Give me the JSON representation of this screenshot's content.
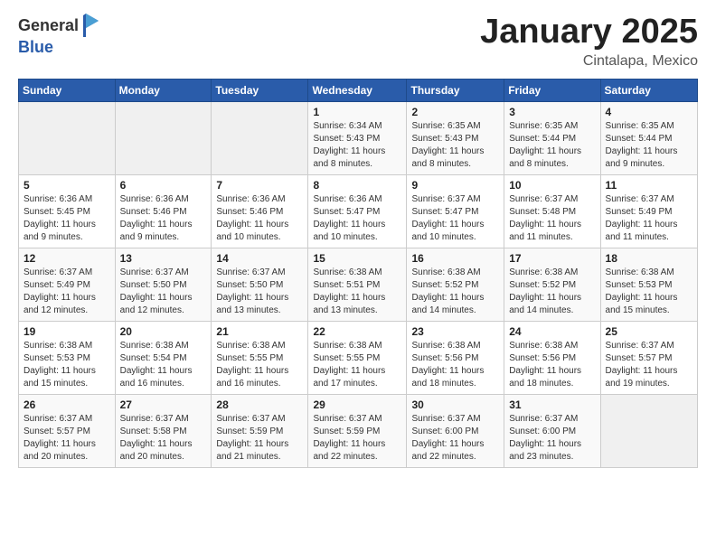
{
  "header": {
    "logo_general": "General",
    "logo_blue": "Blue",
    "month_title": "January 2025",
    "location": "Cintalapa, Mexico"
  },
  "weekdays": [
    "Sunday",
    "Monday",
    "Tuesday",
    "Wednesday",
    "Thursday",
    "Friday",
    "Saturday"
  ],
  "weeks": [
    [
      {
        "day": "",
        "info": ""
      },
      {
        "day": "",
        "info": ""
      },
      {
        "day": "",
        "info": ""
      },
      {
        "day": "1",
        "info": "Sunrise: 6:34 AM\nSunset: 5:43 PM\nDaylight: 11 hours and 8 minutes."
      },
      {
        "day": "2",
        "info": "Sunrise: 6:35 AM\nSunset: 5:43 PM\nDaylight: 11 hours and 8 minutes."
      },
      {
        "day": "3",
        "info": "Sunrise: 6:35 AM\nSunset: 5:44 PM\nDaylight: 11 hours and 8 minutes."
      },
      {
        "day": "4",
        "info": "Sunrise: 6:35 AM\nSunset: 5:44 PM\nDaylight: 11 hours and 9 minutes."
      }
    ],
    [
      {
        "day": "5",
        "info": "Sunrise: 6:36 AM\nSunset: 5:45 PM\nDaylight: 11 hours and 9 minutes."
      },
      {
        "day": "6",
        "info": "Sunrise: 6:36 AM\nSunset: 5:46 PM\nDaylight: 11 hours and 9 minutes."
      },
      {
        "day": "7",
        "info": "Sunrise: 6:36 AM\nSunset: 5:46 PM\nDaylight: 11 hours and 10 minutes."
      },
      {
        "day": "8",
        "info": "Sunrise: 6:36 AM\nSunset: 5:47 PM\nDaylight: 11 hours and 10 minutes."
      },
      {
        "day": "9",
        "info": "Sunrise: 6:37 AM\nSunset: 5:47 PM\nDaylight: 11 hours and 10 minutes."
      },
      {
        "day": "10",
        "info": "Sunrise: 6:37 AM\nSunset: 5:48 PM\nDaylight: 11 hours and 11 minutes."
      },
      {
        "day": "11",
        "info": "Sunrise: 6:37 AM\nSunset: 5:49 PM\nDaylight: 11 hours and 11 minutes."
      }
    ],
    [
      {
        "day": "12",
        "info": "Sunrise: 6:37 AM\nSunset: 5:49 PM\nDaylight: 11 hours and 12 minutes."
      },
      {
        "day": "13",
        "info": "Sunrise: 6:37 AM\nSunset: 5:50 PM\nDaylight: 11 hours and 12 minutes."
      },
      {
        "day": "14",
        "info": "Sunrise: 6:37 AM\nSunset: 5:50 PM\nDaylight: 11 hours and 13 minutes."
      },
      {
        "day": "15",
        "info": "Sunrise: 6:38 AM\nSunset: 5:51 PM\nDaylight: 11 hours and 13 minutes."
      },
      {
        "day": "16",
        "info": "Sunrise: 6:38 AM\nSunset: 5:52 PM\nDaylight: 11 hours and 14 minutes."
      },
      {
        "day": "17",
        "info": "Sunrise: 6:38 AM\nSunset: 5:52 PM\nDaylight: 11 hours and 14 minutes."
      },
      {
        "day": "18",
        "info": "Sunrise: 6:38 AM\nSunset: 5:53 PM\nDaylight: 11 hours and 15 minutes."
      }
    ],
    [
      {
        "day": "19",
        "info": "Sunrise: 6:38 AM\nSunset: 5:53 PM\nDaylight: 11 hours and 15 minutes."
      },
      {
        "day": "20",
        "info": "Sunrise: 6:38 AM\nSunset: 5:54 PM\nDaylight: 11 hours and 16 minutes."
      },
      {
        "day": "21",
        "info": "Sunrise: 6:38 AM\nSunset: 5:55 PM\nDaylight: 11 hours and 16 minutes."
      },
      {
        "day": "22",
        "info": "Sunrise: 6:38 AM\nSunset: 5:55 PM\nDaylight: 11 hours and 17 minutes."
      },
      {
        "day": "23",
        "info": "Sunrise: 6:38 AM\nSunset: 5:56 PM\nDaylight: 11 hours and 18 minutes."
      },
      {
        "day": "24",
        "info": "Sunrise: 6:38 AM\nSunset: 5:56 PM\nDaylight: 11 hours and 18 minutes."
      },
      {
        "day": "25",
        "info": "Sunrise: 6:37 AM\nSunset: 5:57 PM\nDaylight: 11 hours and 19 minutes."
      }
    ],
    [
      {
        "day": "26",
        "info": "Sunrise: 6:37 AM\nSunset: 5:57 PM\nDaylight: 11 hours and 20 minutes."
      },
      {
        "day": "27",
        "info": "Sunrise: 6:37 AM\nSunset: 5:58 PM\nDaylight: 11 hours and 20 minutes."
      },
      {
        "day": "28",
        "info": "Sunrise: 6:37 AM\nSunset: 5:59 PM\nDaylight: 11 hours and 21 minutes."
      },
      {
        "day": "29",
        "info": "Sunrise: 6:37 AM\nSunset: 5:59 PM\nDaylight: 11 hours and 22 minutes."
      },
      {
        "day": "30",
        "info": "Sunrise: 6:37 AM\nSunset: 6:00 PM\nDaylight: 11 hours and 22 minutes."
      },
      {
        "day": "31",
        "info": "Sunrise: 6:37 AM\nSunset: 6:00 PM\nDaylight: 11 hours and 23 minutes."
      },
      {
        "day": "",
        "info": ""
      }
    ]
  ]
}
